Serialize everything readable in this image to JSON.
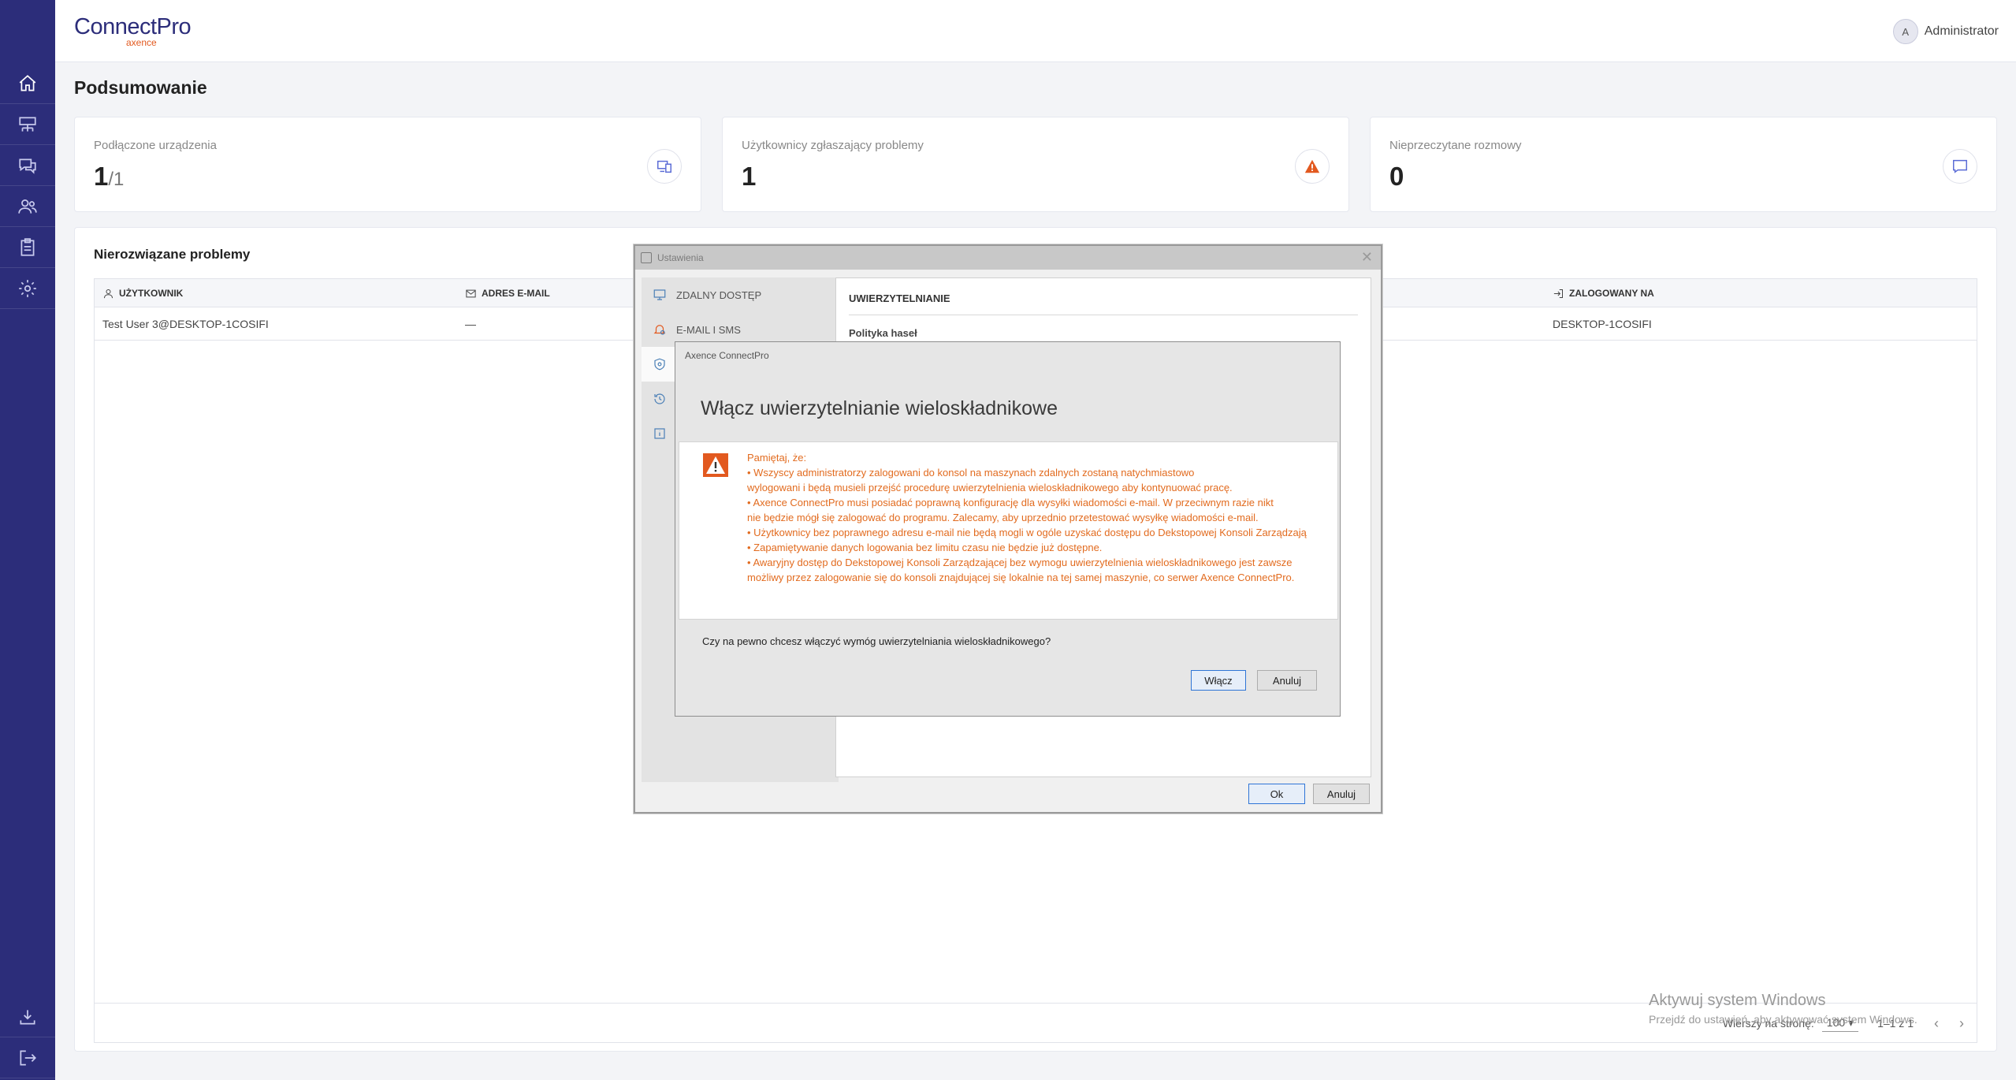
{
  "app": {
    "logo_main": "ConnectPro",
    "logo_sub": "axence",
    "user_initial": "A",
    "username": "Administrator"
  },
  "sidebar": {
    "items": [
      {
        "icon": "home-icon",
        "active": true
      },
      {
        "icon": "devices-icon"
      },
      {
        "icon": "chat-icon"
      },
      {
        "icon": "users-icon"
      },
      {
        "icon": "clipboard-icon"
      },
      {
        "icon": "gear-icon"
      }
    ],
    "bottom_items": [
      {
        "icon": "download-icon"
      },
      {
        "icon": "logout-icon"
      }
    ]
  },
  "page": {
    "title": "Podsumowanie"
  },
  "cards": [
    {
      "label": "Podłączone urządzenia",
      "value": "1",
      "denominator": "/1",
      "icon": "devices-icon",
      "icon_color": "#5a6bd6"
    },
    {
      "label": "Użytkownicy zgłaszający problemy",
      "value": "1",
      "icon": "warning-icon",
      "icon_color": "#e2591f"
    },
    {
      "label": "Nieprzeczytane rozmowy",
      "value": "0",
      "icon": "message-icon",
      "icon_color": "#5a6bd6"
    }
  ],
  "problems": {
    "title": "Nierozwiązane problemy",
    "columns": [
      "UŻYTKOWNIK",
      "ADRES E-MAIL",
      "ZALOGOWANY NA"
    ],
    "rows": [
      {
        "user": "Test User 3@DESKTOP-1COSIFI",
        "email": "—",
        "logged_on": "DESKTOP-1COSIFI"
      }
    ],
    "footer": {
      "rows_per_page_label": "Wierszy na stronę:",
      "rows_per_page": "100",
      "range": "1–1 z 1"
    }
  },
  "watermark": {
    "line1": "Aktywuj system Windows",
    "line2": "Przejdź do ustawień, aby aktywować system Windows."
  },
  "settings_dialog": {
    "title": "Ustawienia",
    "nav": [
      "ZDALNY DOSTĘP",
      "E-MAIL I SMS",
      "",
      "",
      ""
    ],
    "section_title": "UWIERZYTELNIANIE",
    "subsection": "Polityka haseł",
    "ok": "Ok",
    "cancel": "Anuluj"
  },
  "confirm_dialog": {
    "window_title": "Axence ConnectPro",
    "heading": "Włącz uwierzytelnianie wieloskładnikowe",
    "intro": "Pamiętaj, że:",
    "lines": [
      "• Wszyscy administratorzy zalogowani do konsol na maszynach zdalnych zostaną natychmiastowo",
      "   wylogowani i będą musieli przejść procedurę uwierzytelnienia wieloskładnikowego aby kontynuować pracę.",
      "• Axence ConnectPro musi posiadać poprawną konfigurację dla wysyłki wiadomości e-mail. W przeciwnym razie nikt",
      "   nie będzie mógł się zalogować do programu. Zalecamy, aby uprzednio przetestować wysyłkę wiadomości e-mail.",
      "• Użytkownicy bez poprawnego adresu e-mail nie będą mogli w ogóle uzyskać dostępu do Dekstopowej Konsoli Zarządzają",
      "• Zapamiętywanie danych logowania bez limitu czasu nie będzie już dostępne.",
      "• Awaryjny dostęp do Dekstopowej Konsoli Zarządzającej bez wymogu uwierzytelnienia wieloskładnikowego jest zawsze",
      "   możliwy przez zalogowanie się do konsoli znajdującej się lokalnie na tej samej maszynie, co serwer Axence ConnectPro."
    ],
    "question": "Czy na pewno chcesz włączyć wymóg uwierzytelniania wieloskładnikowego?",
    "confirm": "Włącz",
    "cancel": "Anuluj"
  }
}
